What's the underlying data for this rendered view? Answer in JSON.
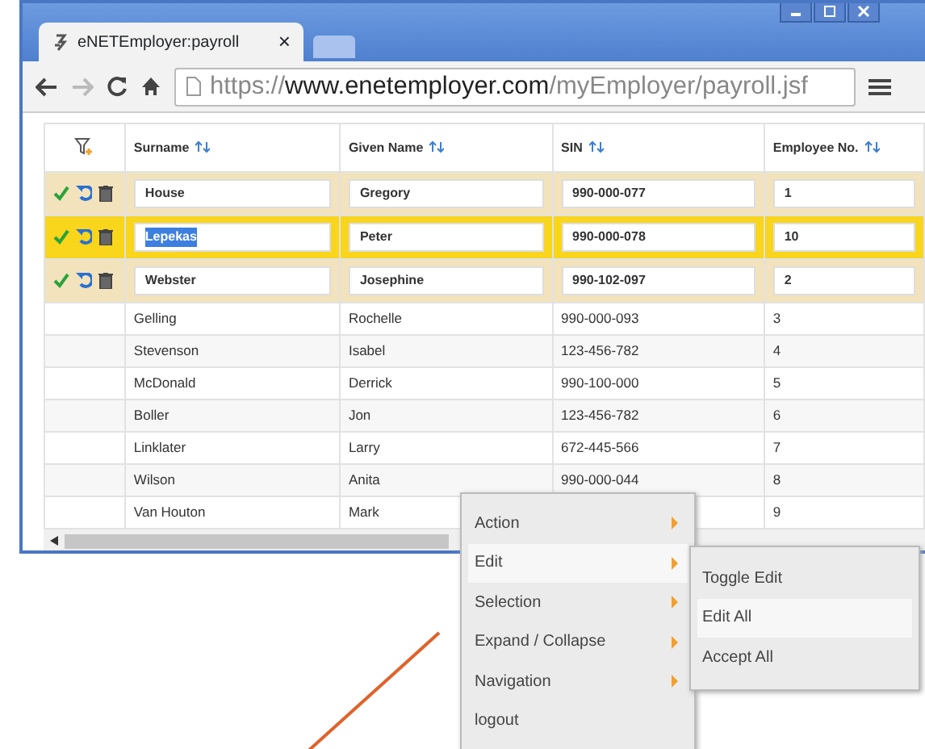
{
  "browser": {
    "tab_title": "eNETEmployer:payroll",
    "tab_close": "×",
    "address": {
      "scheme": "https://",
      "host": "www.enetemployer.com",
      "path": "/myEmployer/payroll.jsf"
    }
  },
  "table": {
    "columns": [
      "Surname",
      "Given Name",
      "SIN",
      "Employee No."
    ],
    "rows": [
      {
        "editing": true,
        "selected": false,
        "cells": [
          "House",
          "Gregory",
          "990-000-077",
          "1"
        ]
      },
      {
        "editing": true,
        "selected": true,
        "cells": [
          "Lepekas",
          "Peter",
          "990-000-078",
          "10"
        ]
      },
      {
        "editing": true,
        "selected": false,
        "cells": [
          "Webster",
          "Josephine",
          "990-102-097",
          "2"
        ]
      },
      {
        "editing": false,
        "selected": false,
        "cells": [
          "Gelling",
          "Rochelle",
          "990-000-093",
          "3"
        ]
      },
      {
        "editing": false,
        "selected": false,
        "cells": [
          "Stevenson",
          "Isabel",
          "123-456-782",
          "4"
        ]
      },
      {
        "editing": false,
        "selected": false,
        "cells": [
          "McDonald",
          "Derrick",
          "990-100-000",
          "5"
        ]
      },
      {
        "editing": false,
        "selected": false,
        "cells": [
          "Boller",
          "Jon",
          "123-456-782",
          "6"
        ]
      },
      {
        "editing": false,
        "selected": false,
        "cells": [
          "Linklater",
          "Larry",
          "672-445-566",
          "7"
        ]
      },
      {
        "editing": false,
        "selected": false,
        "cells": [
          "Wilson",
          "Anita",
          "990-000-044",
          "8"
        ]
      },
      {
        "editing": false,
        "selected": false,
        "cells": [
          "Van Houton",
          "Mark",
          "",
          "9"
        ]
      }
    ]
  },
  "context_menu": {
    "items": [
      {
        "label": "Action",
        "submenu": true,
        "selected": false
      },
      {
        "label": "Edit",
        "submenu": true,
        "selected": true
      },
      {
        "label": "Selection",
        "submenu": true,
        "selected": false
      },
      {
        "label": "Expand / Collapse",
        "submenu": true,
        "selected": false
      },
      {
        "label": "Navigation",
        "submenu": true,
        "selected": false
      },
      {
        "label": "logout",
        "submenu": false,
        "selected": false
      }
    ],
    "submenu": [
      {
        "label": "Toggle Edit",
        "selected": false
      },
      {
        "label": "Edit All",
        "selected": true
      },
      {
        "label": "Accept All",
        "selected": false
      }
    ]
  }
}
